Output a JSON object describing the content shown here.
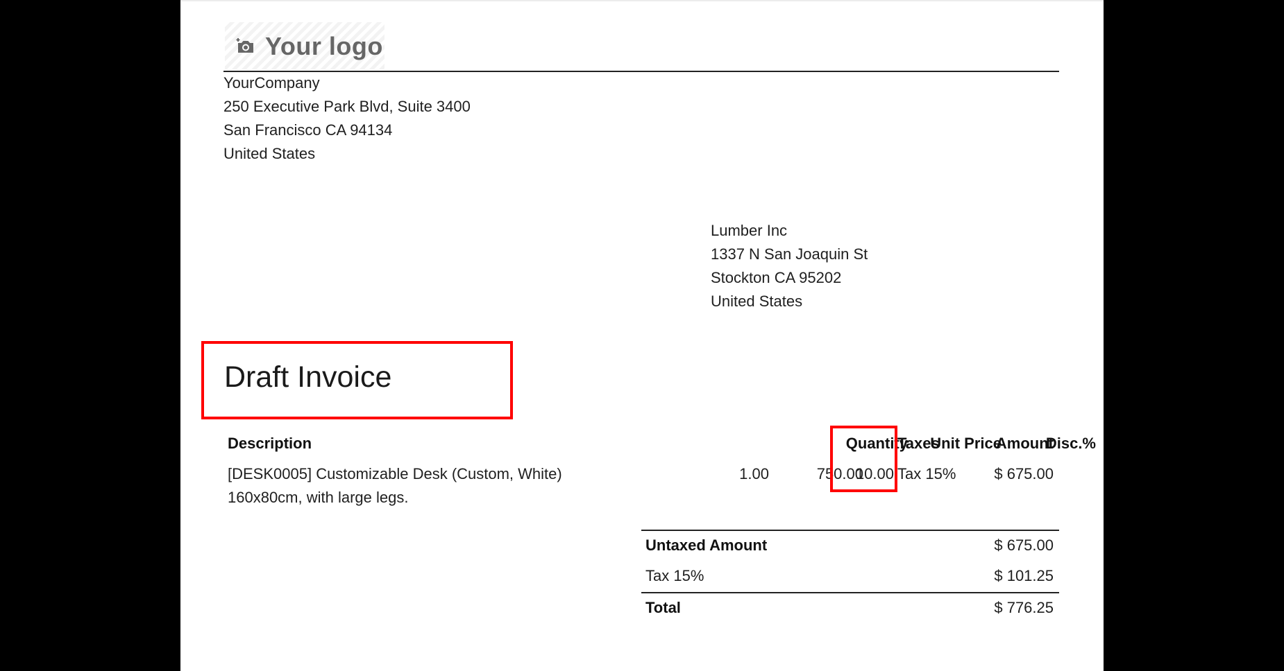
{
  "logo": {
    "text": "Your logo",
    "icon": "camera-icon"
  },
  "company": {
    "name": "YourCompany",
    "street": "250 Executive Park Blvd, Suite 3400",
    "city": "San Francisco CA 94134",
    "country": "United States"
  },
  "customer": {
    "name": "Lumber Inc",
    "street": "1337 N San Joaquin St",
    "city": "Stockton CA 95202",
    "country": "United States"
  },
  "document": {
    "title": "Draft Invoice"
  },
  "table": {
    "headers": {
      "description": "Description",
      "quantity": "Quantity",
      "unit_price": "Unit Price",
      "discount": "Disc.%",
      "taxes": "Taxes",
      "amount": "Amount"
    },
    "rows": [
      {
        "description_line1": "[DESK0005] Customizable Desk (Custom, White)",
        "description_line2": "160x80cm, with large legs.",
        "quantity": "1.00",
        "unit_price": "750.00",
        "discount": "10.00",
        "taxes": "Tax 15%",
        "amount": "$ 675.00"
      }
    ]
  },
  "totals": {
    "untaxed_label": "Untaxed Amount",
    "untaxed_value": "$ 675.00",
    "tax_label": "Tax 15%",
    "tax_value": "$ 101.25",
    "total_label": "Total",
    "total_value": "$ 776.25"
  },
  "colors": {
    "highlight": "#ff0000",
    "background": "#000000",
    "page": "#ffffff"
  }
}
